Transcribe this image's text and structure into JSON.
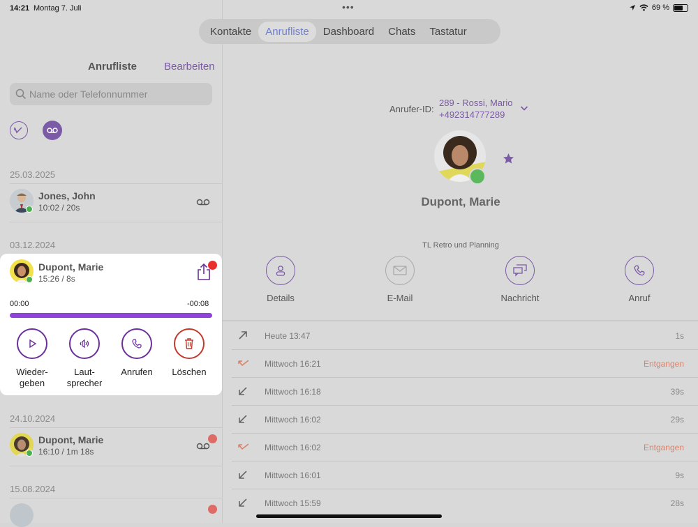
{
  "status": {
    "time": "14:21",
    "date": "Montag 7. Juli",
    "battery": "69 %"
  },
  "tabs": [
    "Kontakte",
    "Anrufliste",
    "Dashboard",
    "Chats",
    "Tastatur"
  ],
  "left": {
    "title": "Anrufliste",
    "edit": "Bearbeiten",
    "search_placeholder": "Name oder Telefonnummer",
    "sections": [
      "25.03.2025",
      "03.12.2024",
      "24.10.2024",
      "15.08.2024"
    ],
    "entries": [
      {
        "name": "Jones, John",
        "detail": "10:02 / 20s"
      },
      {
        "name": "Dupont, Marie",
        "detail": "15:26 / 8s"
      },
      {
        "name": "Dupont, Marie",
        "detail": "16:10 / 1m 18s"
      }
    ],
    "player": {
      "elapsed": "00:00",
      "remaining": "-00:08",
      "progress": 1.0,
      "actions": {
        "play": "Wieder-\ngeben",
        "speaker": "Laut-\nsprecher",
        "call": "Anrufen",
        "delete": "Löschen"
      }
    }
  },
  "right": {
    "caller_label": "Anrufer-ID:",
    "caller_name": "289 - Rossi, Mario",
    "caller_number": "+492314777289",
    "contact_name": "Dupont, Marie",
    "status_text": "TL Retro und Planning",
    "actions": [
      "Details",
      "E-Mail",
      "Nachricht",
      "Anruf"
    ],
    "history": [
      {
        "when": "Heute 13:47",
        "duration": "1s",
        "type": "outgoing"
      },
      {
        "when": "Mittwoch 16:21",
        "duration": "Entgangen",
        "type": "missed"
      },
      {
        "when": "Mittwoch 16:18",
        "duration": "39s",
        "type": "incoming"
      },
      {
        "when": "Mittwoch 16:02",
        "duration": "29s",
        "type": "incoming"
      },
      {
        "when": "Mittwoch 16:02",
        "duration": "Entgangen",
        "type": "missed"
      },
      {
        "when": "Mittwoch 16:01",
        "duration": "9s",
        "type": "incoming"
      },
      {
        "when": "Mittwoch 15:59",
        "duration": "28s",
        "type": "incoming"
      }
    ]
  },
  "colors": {
    "accent": "#7b5aa6",
    "progress": "#8e44d9",
    "missed": "#d9836b",
    "delete": "#c0392b"
  }
}
